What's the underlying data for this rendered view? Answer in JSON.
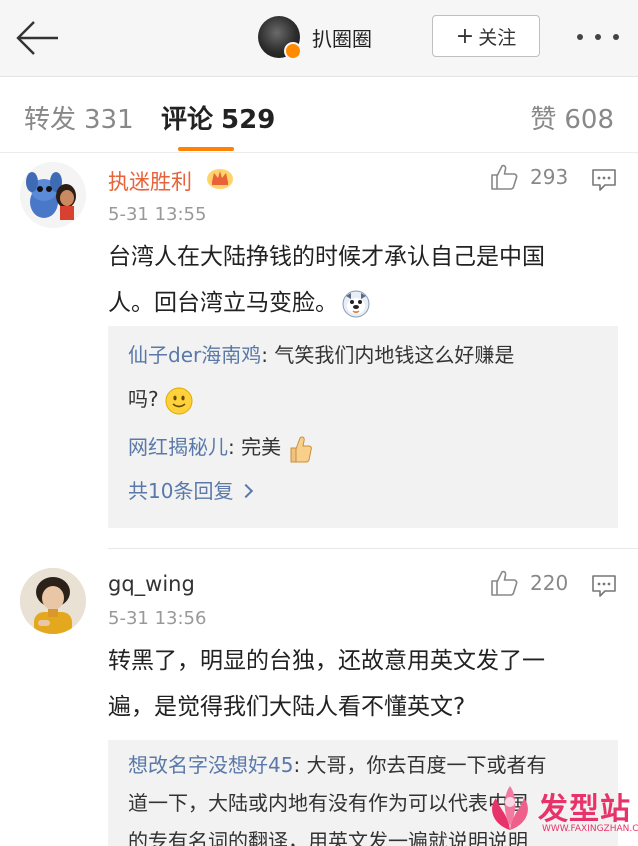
{
  "header": {
    "username": "扒圈圈",
    "follow_label": "关注",
    "follow_plus": "+",
    "colors": {
      "background": "#f6f6f6",
      "verified_badge": "#ff8a00"
    },
    "icons": {
      "back": "arrow-left-icon",
      "more": "more-dots-icon"
    }
  },
  "tabs": {
    "repost": {
      "label": "转发",
      "count": "331"
    },
    "comments": {
      "label": "评论",
      "count": "529",
      "active": true
    },
    "likes": {
      "label": "赞",
      "count": "608"
    },
    "accent_color": "#ff8200"
  },
  "comments": [
    {
      "username": "执迷胜利",
      "time": "5-31 13:55",
      "likes": "293",
      "text_line1": "台湾人在大陆挣钱的时候才承认自己是中国",
      "text_line2": "人。回台湾立马变脸。",
      "icons": {
        "member": "crown-icon",
        "emoji": "dog-emoji-icon"
      },
      "replies": [
        {
          "name": "仙子der海南鸡",
          "text_line1": ": 气笑我们内地钱这么好赚是",
          "text_line2": "吗?"
        },
        {
          "name": "网红揭秘儿",
          "text_line1": ": 完美"
        }
      ],
      "more_replies": "共10条回复"
    },
    {
      "username": "gq_wing",
      "time": "5-31 13:56",
      "likes": "220",
      "text_line1": "转黑了，明显的台独，还故意用英文发了一",
      "text_line2": "遍，是觉得我们大陆人看不懂英文?",
      "replies": [
        {
          "name": "想改名字没想好45",
          "text_line1": ": 大哥，你去百度一下或者有",
          "text_line2": "道一下，大陆或内地有没有作为可以代表中国",
          "text_line3": "的专有名词的翻译，用英文发一遍就说明说明"
        }
      ]
    }
  ],
  "watermark": {
    "text": "发型站",
    "url": "WWW.FAXINGZHAN.COM"
  }
}
